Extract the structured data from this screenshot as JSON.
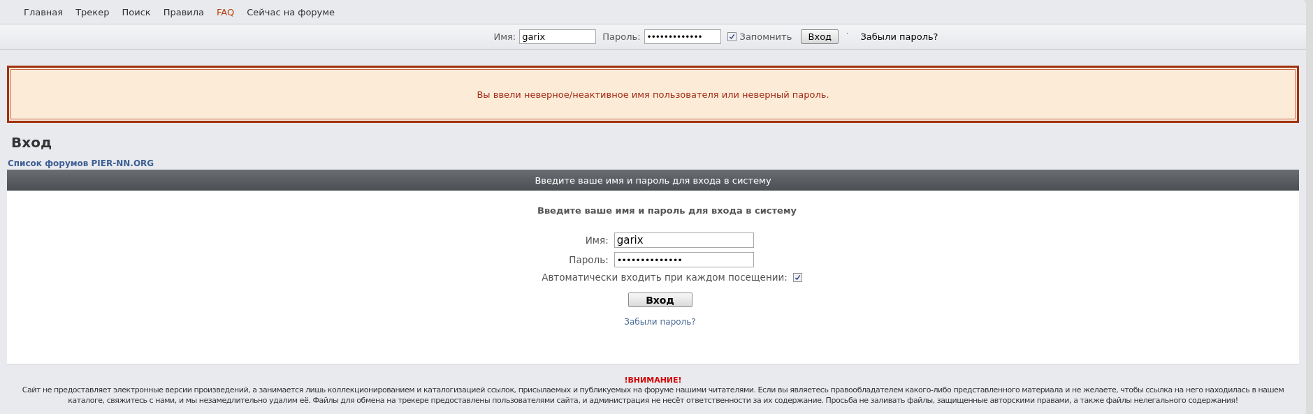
{
  "nav": {
    "links": [
      {
        "label": "Главная",
        "highlighted": false
      },
      {
        "label": "Трекер",
        "highlighted": false
      },
      {
        "label": "Поиск",
        "highlighted": false
      },
      {
        "label": "Правила",
        "highlighted": false
      },
      {
        "label": "FAQ",
        "highlighted": true
      },
      {
        "label": "Сейчас на форуме",
        "highlighted": false
      }
    ]
  },
  "login_bar": {
    "username_label": "Имя:",
    "username": "garix",
    "password_label": "Пароль:",
    "password": "•••••••••••••",
    "remember_label": "Запомнить",
    "remember_checked": true,
    "button": "Вход",
    "separator": "·",
    "forgot_link": "Забыли пароль?"
  },
  "error_message": "Вы ввели неверное/неактивное имя пользователя или неверный пароль.",
  "page_title": "Вход",
  "breadcrumb": "Список форумов PIER-NN.ORG",
  "login_panel": {
    "header": "Введите ваше имя и пароль для входа в систему",
    "title": "Введите ваше имя и пароль для входа в систему",
    "username_label": "Имя:",
    "username": "garix",
    "password_label": "Пароль:",
    "password": "••••••••••••••",
    "autologin_label": "Автоматически входить при каждом посещении:",
    "autologin_checked": true,
    "button": "Вход",
    "forgot_link": "Забыли пароль?"
  },
  "footer": {
    "heading": "!ВНИМАНИЕ!",
    "text": "Сайт не предоставляет электронные версии произведений, а занимается лишь коллекционированием и каталогизацией ссылок, присылаемых и публикуемых на форуме нашими читателями. Если вы являетесь правообладателем какого-либо представленного материала и не желаете, чтобы ссылка на него находилась в нашем каталоге, свяжитесь с нами, и мы незамедлительно удалим её. Файлы для обмена на трекере предоставлены пользователями сайта, и администрация не несёт ответственности за их содержание. Просьба не заливать файлы, защищенные авторскими правами, а также файлы нелегального содержания!"
  }
}
